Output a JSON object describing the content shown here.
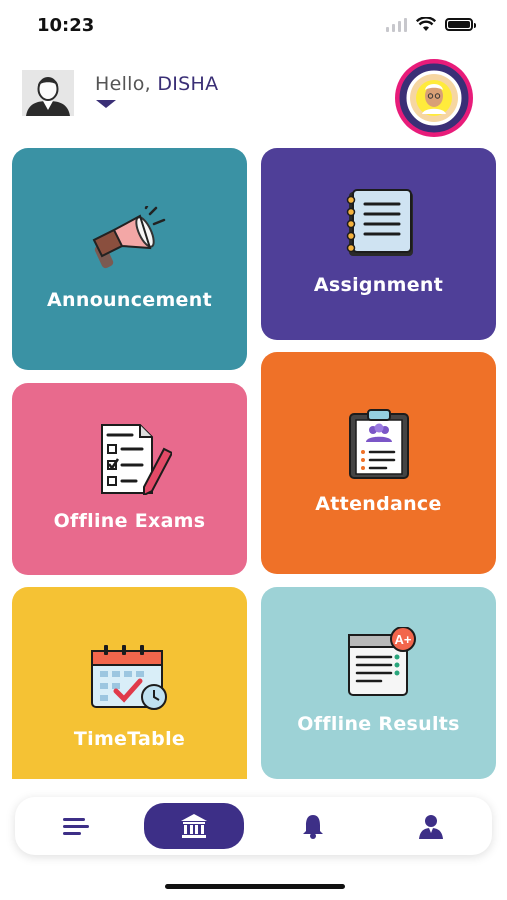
{
  "status_bar": {
    "time": "10:23"
  },
  "header": {
    "greeting": "Hello,",
    "user_name": "DISHA",
    "school_logo_text": "DR. C. G. ENGLISH SCHOOL · ENTER TO LEARN · GO OUT TO SERVE · SARDARNAGAR"
  },
  "tiles": [
    {
      "label": "Announcement",
      "color": "#3a92a4",
      "icon": "megaphone-icon"
    },
    {
      "label": "Assignment",
      "color": "#4f3f98",
      "icon": "notebook-icon"
    },
    {
      "label": "Offline Exams",
      "color": "#e86a8d",
      "icon": "exam-paper-icon"
    },
    {
      "label": "Attendance",
      "color": "#ef7128",
      "icon": "clipboard-icon"
    },
    {
      "label": "TimeTable",
      "color": "#f5c234",
      "icon": "calendar-icon"
    },
    {
      "label": "Offline Results",
      "color": "#9dd2d6",
      "icon": "result-sheet-icon"
    }
  ],
  "bottom_nav": {
    "items": [
      {
        "icon": "menu-icon",
        "active": false
      },
      {
        "icon": "institution-icon",
        "active": true
      },
      {
        "icon": "bell-icon",
        "active": false
      },
      {
        "icon": "profile-icon",
        "active": false
      }
    ],
    "accent": "#3d2f87"
  }
}
